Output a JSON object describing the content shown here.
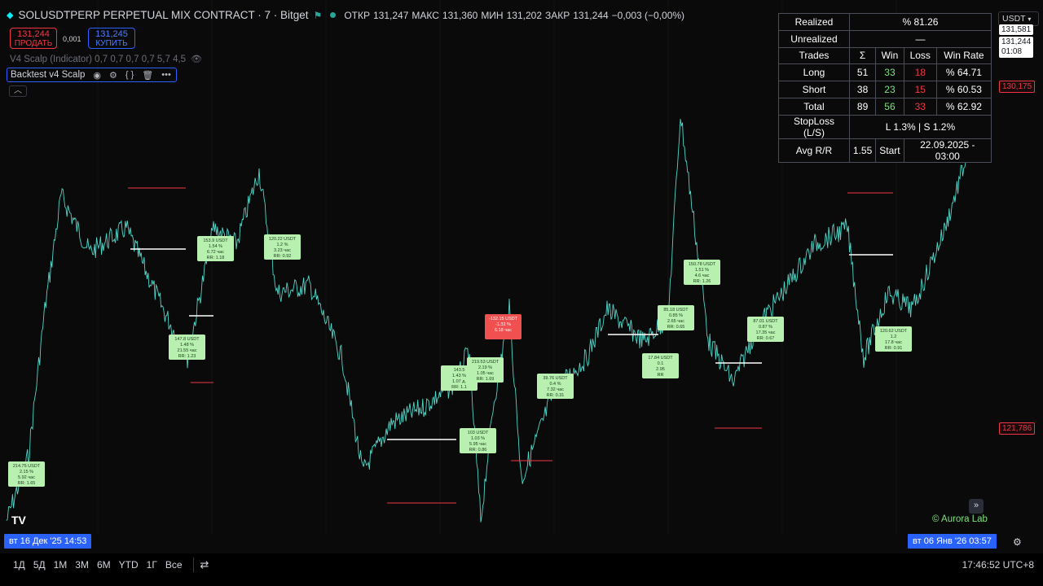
{
  "symbol": {
    "title": "SOLUSDTPERP PERPETUAL MIX CONTRACT · 7 · Bitget"
  },
  "ohlc": {
    "open_label": "ОТКР",
    "open": "131,247",
    "high_label": "МАКС",
    "high": "131,360",
    "low_label": "МИН",
    "low": "131,202",
    "close_label": "ЗАКР",
    "close": "131,244",
    "change": "−0,003 (−0,00%)"
  },
  "trade": {
    "sell_price": "131,244",
    "sell_label": "ПРОДАТЬ",
    "buy_price": "131,245",
    "buy_label": "КУПИТЬ",
    "spread": "0,001"
  },
  "indicator": {
    "label": "V4 Scalp (Indicator) 0,7 0,7 0,7 0,7 5,7 4,5"
  },
  "strategy": {
    "label": "Backtest v4 Scalp"
  },
  "price_scale": {
    "currency": "USDT",
    "tags": [
      "131,581",
      "131,244",
      "01:08",
      "130,175",
      "121,786"
    ]
  },
  "stats": {
    "realized_label": "Realized",
    "realized_value": "% 81.26",
    "unrealized_label": "Unrealized",
    "unrealized_value": "—",
    "headers": [
      "Trades",
      "Σ",
      "Win",
      "Loss",
      "Win Rate"
    ],
    "rows": [
      {
        "name": "Long",
        "total": "51",
        "win": "33",
        "loss": "18",
        "rate": "% 64.71"
      },
      {
        "name": "Short",
        "total": "38",
        "win": "23",
        "loss": "15",
        "rate": "% 60.53"
      },
      {
        "name": "Total",
        "total": "89",
        "win": "56",
        "loss": "33",
        "rate": "% 62.92"
      }
    ],
    "stoploss_label": "StopLoss (L/S)",
    "stoploss_value": "L 1.3% | S 1.2%",
    "avgrr_label": "Avg R/R",
    "avgrr_value": "1.55",
    "start_label": "Start",
    "start_value": "22.09.2025 - 03:00"
  },
  "trade_labels": [
    [
      "214.75 USDT",
      "2.15 %",
      "5.92 час",
      "RR: 1.65"
    ],
    [
      "147.8 USDT",
      "1.48 %",
      "21.55 час",
      "RR: 1.23"
    ],
    [
      "153.9 USDT",
      "1.54 %",
      "6.72 час",
      "RR: 1.18"
    ],
    [
      "120.22 USDT",
      "1.2 %",
      "3.23 час",
      "RR: 0.92"
    ],
    [
      "143.5",
      "1.43 %",
      "1.07 д.",
      "RR: 1.1"
    ],
    [
      "219.53 USDT",
      "2.19 %",
      "1.05 час",
      "RR: 1.69"
    ],
    [
      "103 USDT",
      "1.03 %",
      "5.95 час",
      "RR: 0.86"
    ],
    [
      "-132.15 USDT",
      "-1.32 %",
      "6.18 час",
      ""
    ],
    [
      "39.76 USDT",
      "0.4 %",
      "7.32 час",
      "RR: 0.31"
    ],
    [
      "85.18 USDT",
      "0.85 %",
      "2.65 час",
      "RR: 0.65"
    ],
    [
      "17.84 USDT",
      "0.1",
      "2.95",
      "RR"
    ],
    [
      "150.78 USDT",
      "1.51 %",
      "4.6 час",
      "RR: 1.26"
    ],
    [
      "87.01 USDT",
      "0.87 %",
      "17.35 час",
      "RR: 0.67"
    ],
    [
      "120.62 USDT",
      "1.2",
      "17.8 час",
      "RR: 0.91"
    ]
  ],
  "xaxis": {
    "left_date": "вт 16 Дек '25   14:53",
    "right_date": "вт 06 Янв '26   03:57"
  },
  "bottom": {
    "ranges": [
      "1Д",
      "5Д",
      "1М",
      "3М",
      "6М",
      "YTD",
      "1Г",
      "Все"
    ],
    "clock": "17:46:52 UTC+8"
  },
  "watermark": "© Aurora Lab",
  "logo": "TV"
}
